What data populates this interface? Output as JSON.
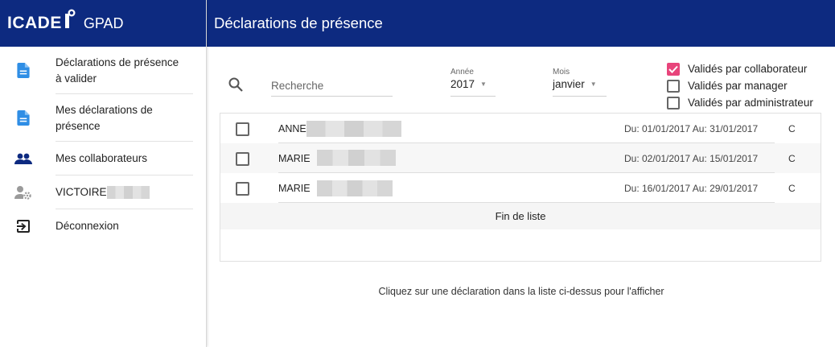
{
  "brand": {
    "logo_text": "ICADE",
    "app_name": "GPAD"
  },
  "header": {
    "title": "Déclarations de présence"
  },
  "sidebar": {
    "items": [
      {
        "label_line1": "Déclarations de présence",
        "label_line2": "à valider",
        "icon": "document-icon"
      },
      {
        "label_line1": "Mes déclarations de",
        "label_line2": "présence",
        "icon": "document-icon"
      },
      {
        "label": "Mes collaborateurs",
        "icon": "people-icon"
      },
      {
        "label": "VICTOIRE",
        "icon": "user-settings-icon"
      },
      {
        "label": "Déconnexion",
        "icon": "logout-icon"
      }
    ]
  },
  "search": {
    "placeholder": "Recherche",
    "value": ""
  },
  "year_select": {
    "caption": "Année",
    "value": "2017"
  },
  "month_select": {
    "caption": "Mois",
    "value": "janvier"
  },
  "filters": [
    {
      "label": "Validés par collaborateur",
      "checked": true
    },
    {
      "label": "Validés par manager",
      "checked": false
    },
    {
      "label": "Validés par administrateur",
      "checked": false
    }
  ],
  "rows": [
    {
      "name": "ANNE",
      "period": "Du: 01/01/2017 Au: 31/01/2017",
      "status": "C"
    },
    {
      "name": "MARIE",
      "period": "Du: 02/01/2017 Au: 15/01/2017",
      "status": "C"
    },
    {
      "name": "MARIE",
      "period": "Du: 16/01/2017 Au: 29/01/2017",
      "status": "C"
    }
  ],
  "list_end": "Fin de liste",
  "hint": "Cliquez sur une déclaration dans la liste ci-dessus pour l'afficher",
  "colors": {
    "primary": "#0d2a80",
    "accent": "#e8447b",
    "icon_blue": "#2f8ee5"
  }
}
